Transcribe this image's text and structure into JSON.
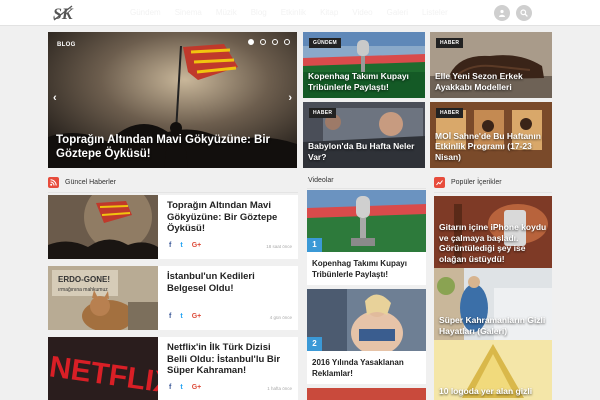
{
  "header": {
    "logo_text": "SK",
    "nav": [
      "Gündem",
      "Sinema",
      "Müzik",
      "Blog",
      "Etkinlik",
      "Kitap",
      "Video",
      "Galeri",
      "Listeler"
    ]
  },
  "hero": {
    "tag": "BLOG",
    "title": "Toprağın Altından Mavi Gökyüzüne: Bir Göztepe Öyküsü!",
    "prev": "‹",
    "next": "›",
    "dot_count": 4,
    "active_dot": 1
  },
  "grid": [
    {
      "tag": "GÜNDEM",
      "title": "Kopenhag Takımı Kupayı Tribünlerle Paylaştı!"
    },
    {
      "tag": "HABER",
      "title": "Elle Yeni Sezon Erkek Ayakkabı Modelleri"
    },
    {
      "tag": "HABER",
      "title": "Babylon'da Bu Hafta Neler Var?"
    },
    {
      "tag": "HABER",
      "title": "MOİ Sahne'de Bu Haftanın Etkinlik Programı (17-23 Nisan)"
    }
  ],
  "sections": {
    "news": "Güncel Haberler",
    "videos": "Videolar",
    "popular": "Popüler İçerikler"
  },
  "share": {
    "fb": "f",
    "tw": "t",
    "gp": "G+"
  },
  "news": [
    {
      "title": "Toprağın Altından Mavi Gökyüzüne: Bir Göztepe Öyküsü!",
      "time": "18 saat önce"
    },
    {
      "title": "İstanbul'un Kedileri Belgesel Oldu!",
      "time": "4 gün önce"
    },
    {
      "title": "Netflix'in İlk Türk Dizisi Belli Oldu: İstanbul'lu Bir Süper Kahraman!",
      "time": "1 hafta önce"
    }
  ],
  "videos": [
    {
      "num": "1",
      "title": "Kopenhag Takımı Kupayı Tribünlerle Paylaştı!"
    },
    {
      "num": "2",
      "title": "2016 Yılında Yasaklanan Reklamlar!"
    }
  ],
  "popular": [
    {
      "title": "Gitarın içine iPhone koydu ve çalmaya başladı. Görüntülediği şey ise olağan üstüydü!"
    },
    {
      "title": "Süper Kahramanların Gizli Hayatları (Galeri)"
    },
    {
      "title": "10 logoda yer alan gizli"
    }
  ],
  "thumb_text": {
    "cats_sign": "ERDO-GONE!",
    "cats_sub": "ırmağınına mahkumuz",
    "netflix": "NETFLIX"
  },
  "colors": {
    "accent_red": "#e74c3c",
    "video_blue": "#3b99d6",
    "facebook": "#3b5998",
    "twitter": "#1da1f2",
    "google": "#dd4b39"
  }
}
